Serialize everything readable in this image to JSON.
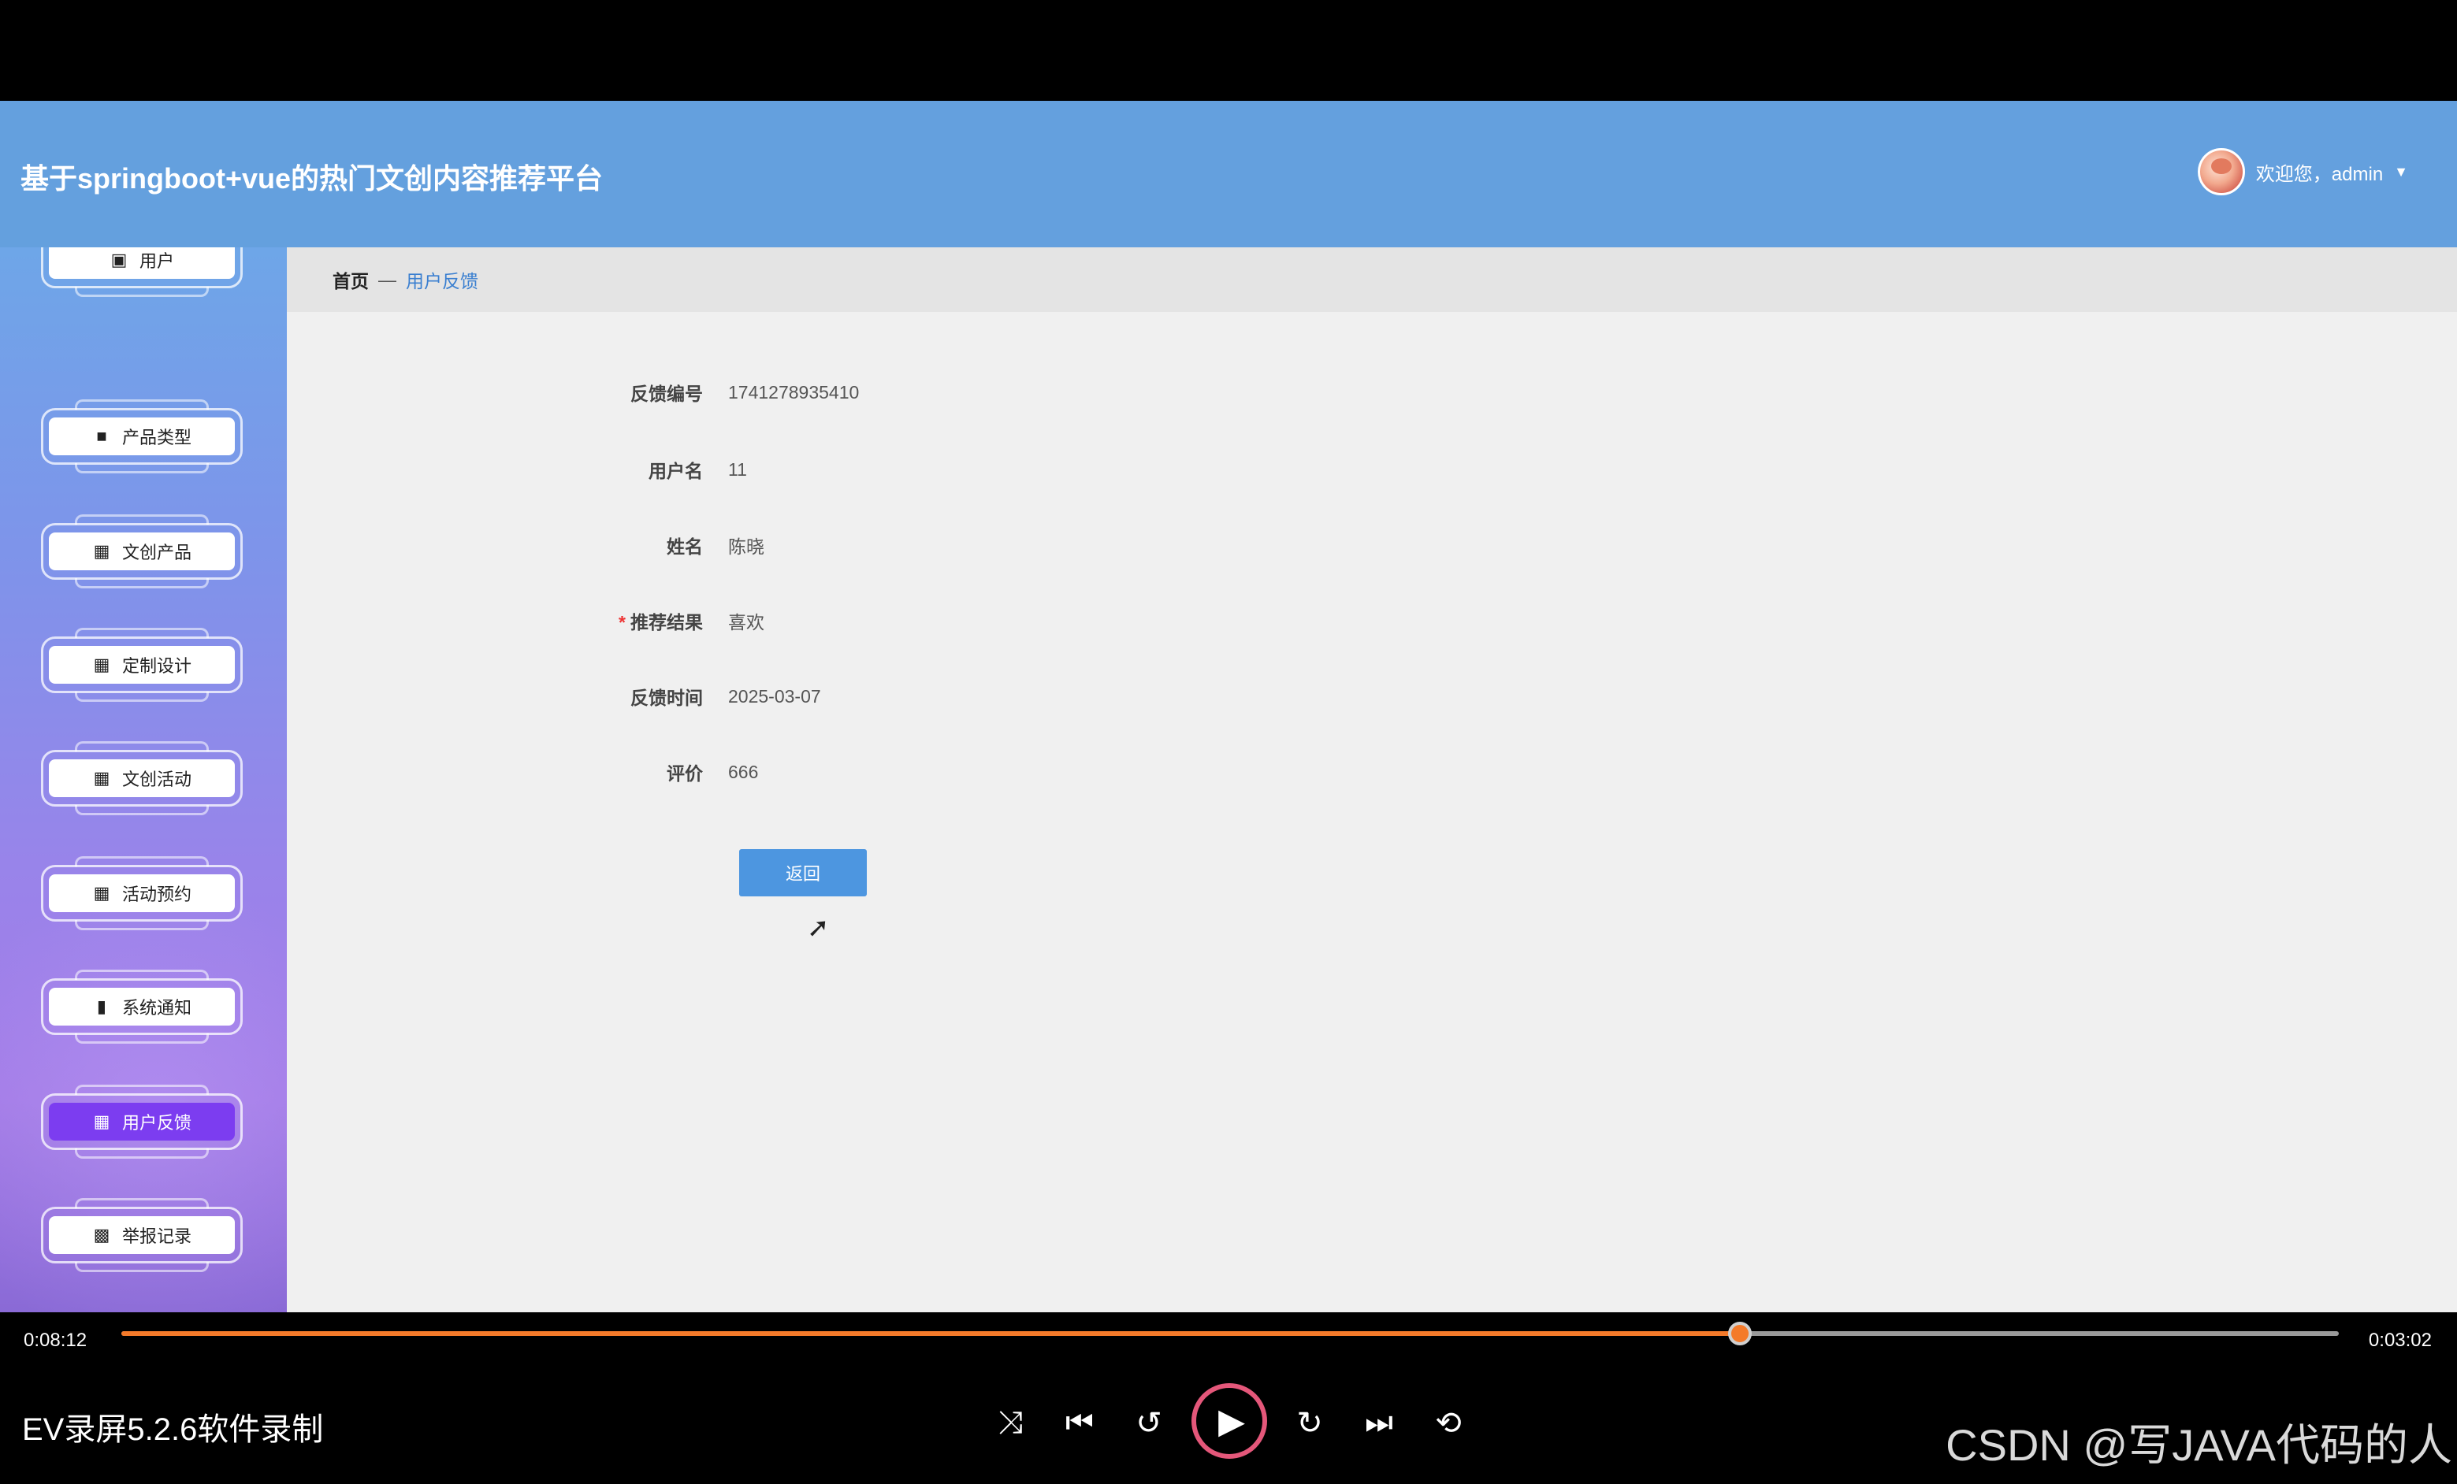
{
  "header": {
    "title": "基于springboot+vue的热门文创内容推荐平台",
    "welcome": "欢迎您，admin",
    "caret": "▼"
  },
  "sidebar": {
    "items": [
      {
        "label": "用户",
        "icon": "user-icon",
        "glyph": "▣"
      },
      {
        "label": "产品类型",
        "icon": "folder-icon",
        "glyph": "■"
      },
      {
        "label": "文创产品",
        "icon": "grid-icon",
        "glyph": "▦"
      },
      {
        "label": "定制设计",
        "icon": "grid-icon",
        "glyph": "▦"
      },
      {
        "label": "文创活动",
        "icon": "grid-icon",
        "glyph": "▦"
      },
      {
        "label": "活动预约",
        "icon": "grid-icon",
        "glyph": "▦"
      },
      {
        "label": "系统通知",
        "icon": "bar-chart-icon",
        "glyph": "▮"
      },
      {
        "label": "用户反馈",
        "icon": "grid-icon",
        "glyph": "▦",
        "active": true
      },
      {
        "label": "举报记录",
        "icon": "apps-icon",
        "glyph": "▩"
      }
    ]
  },
  "breadcrumb": {
    "home": "首页",
    "separator": "—",
    "current": "用户反馈"
  },
  "form": {
    "rows": [
      {
        "label": "反馈编号",
        "value": "1741278935410"
      },
      {
        "label": "用户名",
        "value": "11"
      },
      {
        "label": "姓名",
        "value": "陈晓"
      },
      {
        "label": "推荐结果",
        "value": "喜欢",
        "required": true
      },
      {
        "label": "反馈时间",
        "value": "2025-03-07"
      },
      {
        "label": "评价",
        "value": "666"
      }
    ],
    "required_mark": "*",
    "back_label": "返回"
  },
  "player": {
    "elapsed": "0:08:12",
    "total": "0:03:02",
    "progress": 0.73,
    "recorder": "EV录屏5.2.6软件录制",
    "watermark": "CSDN @写JAVA代码的人"
  },
  "colors": {
    "header_bg": "#64a0de",
    "accent": "#4d96e0",
    "active_nav": "#7c3df0",
    "progress": "#f47a2a"
  }
}
